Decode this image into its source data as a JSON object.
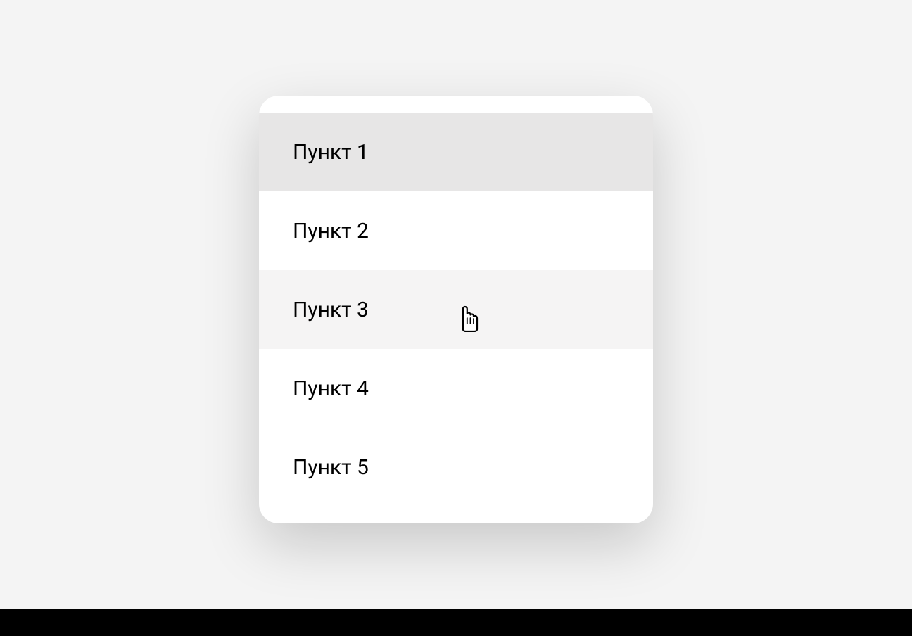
{
  "menu": {
    "items": [
      {
        "label": "Пункт 1",
        "state": "selected"
      },
      {
        "label": "Пункт 2",
        "state": "normal"
      },
      {
        "label": "Пункт 3",
        "state": "hovered"
      },
      {
        "label": "Пункт 4",
        "state": "normal"
      },
      {
        "label": "Пункт 5",
        "state": "normal"
      }
    ]
  }
}
